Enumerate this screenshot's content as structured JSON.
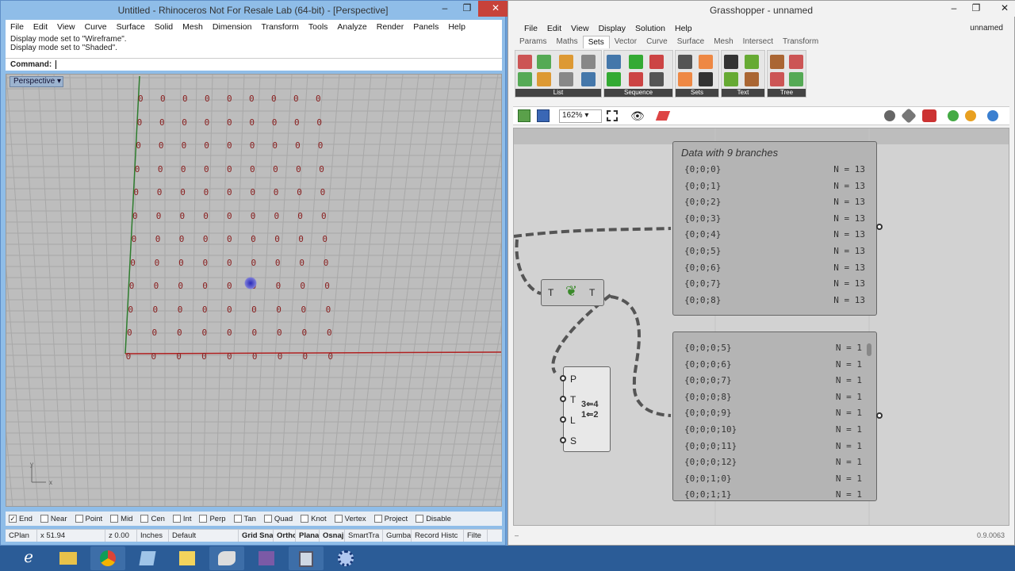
{
  "rhino": {
    "title": "Untitled - Rhinoceros Not For Resale Lab (64-bit) - [Perspective]",
    "menu": [
      "File",
      "Edit",
      "View",
      "Curve",
      "Surface",
      "Solid",
      "Mesh",
      "Dimension",
      "Transform",
      "Tools",
      "Analyze",
      "Render",
      "Panels",
      "Help"
    ],
    "history": [
      "Display mode set to \"Wireframe\".",
      "Display mode set to \"Shaded\"."
    ],
    "command_label": "Command:",
    "viewport_tab": "Perspective",
    "grid_glyph": "0",
    "osnaps": [
      {
        "label": "End",
        "checked": true
      },
      {
        "label": "Near",
        "checked": false
      },
      {
        "label": "Point",
        "checked": false
      },
      {
        "label": "Mid",
        "checked": false
      },
      {
        "label": "Cen",
        "checked": false
      },
      {
        "label": "Int",
        "checked": false
      },
      {
        "label": "Perp",
        "checked": false
      },
      {
        "label": "Tan",
        "checked": false
      },
      {
        "label": "Quad",
        "checked": false
      },
      {
        "label": "Knot",
        "checked": false
      },
      {
        "label": "Vertex",
        "checked": false
      },
      {
        "label": "Project",
        "checked": false
      },
      {
        "label": "Disable",
        "checked": false
      }
    ],
    "status": [
      "CPlan",
      "x 51.94",
      "z 0.00",
      "Inches",
      "Default",
      "Grid Sna",
      "Orthc",
      "Plana",
      "Osnaj",
      "SmartTra",
      "Gumba",
      "Record Histc",
      "Filte"
    ]
  },
  "gh": {
    "title": "Grasshopper - unnamed",
    "menu": [
      "File",
      "Edit",
      "View",
      "Display",
      "Solution",
      "Help"
    ],
    "doc": "unnamed",
    "tabs": [
      "Params",
      "Maths",
      "Sets",
      "Vector",
      "Curve",
      "Surface",
      "Mesh",
      "Intersect",
      "Transform"
    ],
    "active_tab": "Sets",
    "groups": [
      "List",
      "Sequence",
      "Sets",
      "Text",
      "Tree"
    ],
    "zoom": "162%",
    "panel1": {
      "title": "Data with 9 branches",
      "rows": [
        {
          "path": "{0;0;0}",
          "n": "N = 13"
        },
        {
          "path": "{0;0;1}",
          "n": "N = 13"
        },
        {
          "path": "{0;0;2}",
          "n": "N = 13"
        },
        {
          "path": "{0;0;3}",
          "n": "N = 13"
        },
        {
          "path": "{0;0;4}",
          "n": "N = 13"
        },
        {
          "path": "{0;0;5}",
          "n": "N = 13"
        },
        {
          "path": "{0;0;6}",
          "n": "N = 13"
        },
        {
          "path": "{0;0;7}",
          "n": "N = 13"
        },
        {
          "path": "{0;0;8}",
          "n": "N = 13"
        }
      ]
    },
    "panel2": {
      "rows": [
        {
          "path": "{0;0;0;5}",
          "n": "N = 1"
        },
        {
          "path": "{0;0;0;6}",
          "n": "N = 1"
        },
        {
          "path": "{0;0;0;7}",
          "n": "N = 1"
        },
        {
          "path": "{0;0;0;8}",
          "n": "N = 1"
        },
        {
          "path": "{0;0;0;9}",
          "n": "N = 1"
        },
        {
          "path": "{0;0;0;10}",
          "n": "N = 1"
        },
        {
          "path": "{0;0;0;11}",
          "n": "N = 1"
        },
        {
          "path": "{0;0;0;12}",
          "n": "N = 1"
        },
        {
          "path": "{0;0;1;0}",
          "n": "N = 1"
        },
        {
          "path": "{0;0;1;1}",
          "n": "N = 1"
        }
      ]
    },
    "flatten": {
      "in": "T",
      "out": "T"
    },
    "relative": {
      "inputs": [
        "P",
        "T",
        "L",
        "S"
      ]
    },
    "version": "0.9.0063"
  }
}
